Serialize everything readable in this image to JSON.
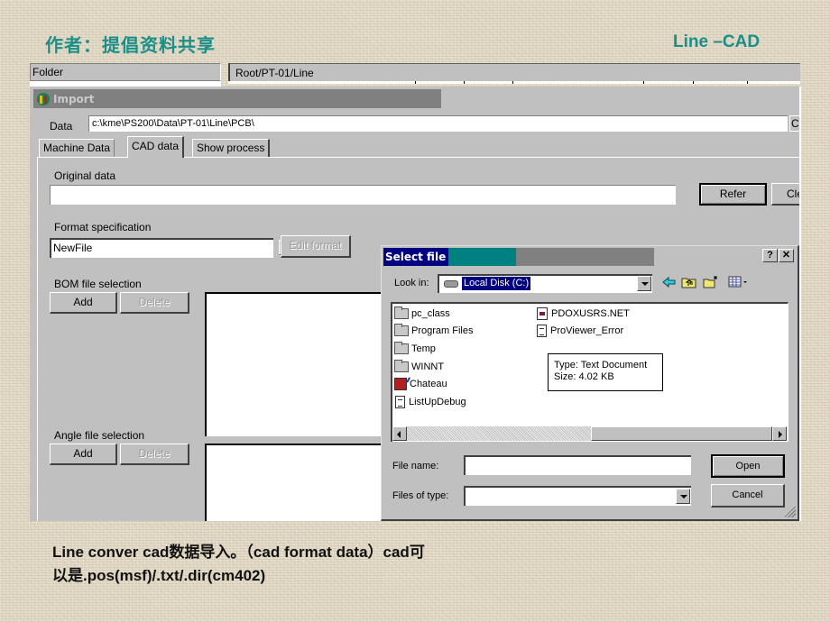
{
  "slide": {
    "title_left": "作者：提倡资料共享",
    "title_right": "Line –CAD",
    "accent_color": "#1b8f87",
    "caption_line1": "Line conver cad数据导入。（cad format data）cad可",
    "caption_line2": "以是.pos(msf)/.txt/.dir(cm402)"
  },
  "background_app": {
    "folder_header": "Folder",
    "path_header": "Root/PT-01/Line"
  },
  "import_window": {
    "title": "Import",
    "data_label": "Data",
    "data_path": "c:\\kme\\PS200\\Data\\PT-01\\Line\\PCB\\",
    "data_side_button": "C",
    "tabs": [
      {
        "label": "Machine Data",
        "active": false
      },
      {
        "label": "CAD data",
        "active": true
      },
      {
        "label": "Show process",
        "active": false
      }
    ],
    "original_data_label": "Original data",
    "original_data_value": "",
    "refer_button": "Refer",
    "clear_button": "Clear",
    "format_spec_label": "Format specification",
    "format_spec_value": "NewFile",
    "edit_format_button": "Edit format",
    "bom_label": "BOM file selection",
    "bom_add": "Add",
    "bom_delete": "Delete",
    "angle_label": "Angle file selection",
    "angle_add": "Add",
    "angle_delete": "Delete"
  },
  "select_file_dialog": {
    "title": "Select file",
    "help_button": "?",
    "close_button": "✕",
    "look_in_label": "Look in:",
    "look_in_value": "Local Disk (C:)",
    "files_col1": [
      {
        "name": "pc_class",
        "icon": "folder-icon"
      },
      {
        "name": "Program Files",
        "icon": "folder-icon"
      },
      {
        "name": "Temp",
        "icon": "folder-icon"
      },
      {
        "name": "WINNT",
        "icon": "folder-icon"
      },
      {
        "name": "Chateau",
        "icon": "app-icon"
      },
      {
        "name": "ListUpDebug",
        "icon": "text-document-icon"
      }
    ],
    "files_col2": [
      {
        "name": "PDOXUSRS.NET",
        "icon": "net-file-icon"
      },
      {
        "name": "ProViewer_Error",
        "icon": "text-document-icon"
      }
    ],
    "tooltip_line1": "Type: Text Document",
    "tooltip_line2": "Size: 4.02 KB",
    "file_name_label": "File name:",
    "file_name_value": "",
    "files_of_type_label": "Files of type:",
    "files_of_type_value": "",
    "open_button": "Open",
    "cancel_button": "Cancel"
  }
}
